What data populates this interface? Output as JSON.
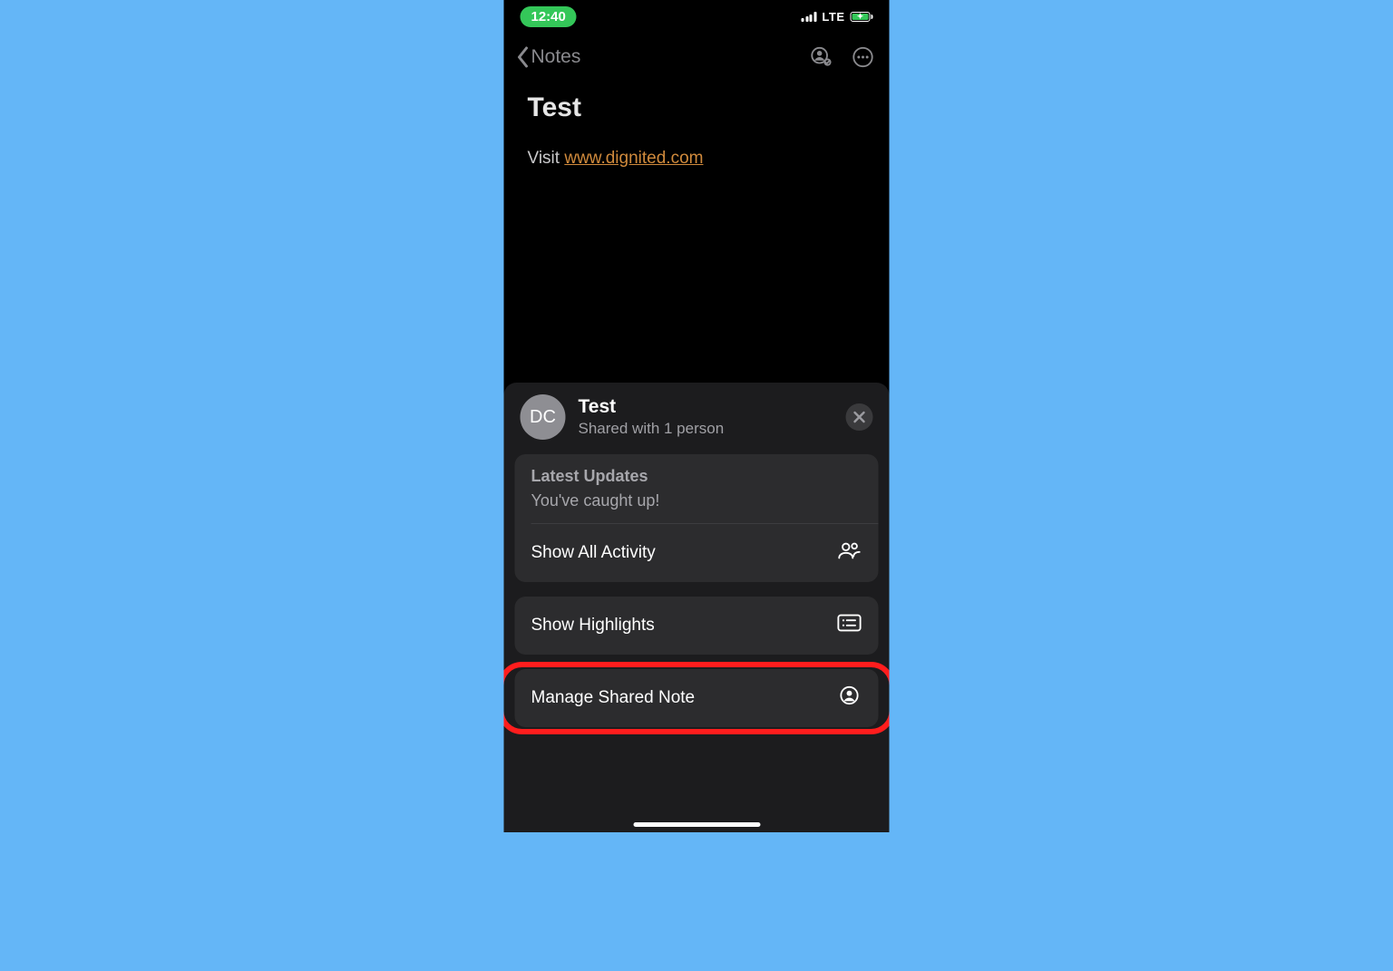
{
  "statusBar": {
    "time": "12:40",
    "networkLabel": "LTE"
  },
  "nav": {
    "backLabel": "Notes"
  },
  "note": {
    "title": "Test",
    "bodyPrefix": "Visit ",
    "linkText": "www.dignited.com"
  },
  "sheet": {
    "avatarInitials": "DC",
    "title": "Test",
    "subtitle": "Shared with 1 person",
    "updates": {
      "heading": "Latest Updates",
      "statusText": "You've caught up!",
      "showAllLabel": "Show All Activity"
    },
    "highlightsLabel": "Show Highlights",
    "manageLabel": "Manage Shared Note"
  }
}
